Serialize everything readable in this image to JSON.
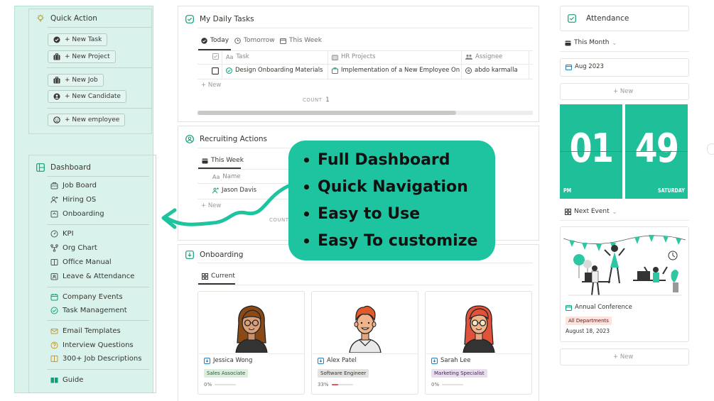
{
  "colors": {
    "accent": "#1ec39f",
    "teal_dark": "#0f9f7a",
    "sidebar_bg": "#d9f2ec"
  },
  "sidebar": {
    "quick_action": {
      "title": "Quick Action",
      "buttons": [
        "+ New Task",
        "+ New Project",
        "+ New Job",
        "+ New Candidate",
        "+ New employee"
      ]
    },
    "dashboard": {
      "title": "Dashboard",
      "items": [
        "Job Board",
        "Hiring OS",
        "Onboarding",
        "KPI",
        "Org Chart",
        "Office Manual",
        "Leave & Attendance",
        "Company Events",
        "Task Management",
        "Email Templates",
        "Interview Questions",
        "300+ Job Descriptions",
        "Guide"
      ]
    }
  },
  "daily_tasks": {
    "title": "My Daily Tasks",
    "tabs": [
      "Today",
      "Tomorrow",
      "This Week"
    ],
    "columns": [
      "Task",
      "HR Projects",
      "Assignee"
    ],
    "rows": [
      {
        "task": "Design Onboarding Materials",
        "project": "Implementation of a New Employee Onboa",
        "assignee": "abdo karmalla"
      }
    ],
    "new_label": "New",
    "count_label": "COUNT",
    "count_value": "1"
  },
  "recruiting": {
    "title": "Recruiting Actions",
    "tab": "This Week",
    "column": "Name",
    "rows": [
      "Jason Davis"
    ],
    "new_label": "New",
    "count_label": "COUNT"
  },
  "onboarding": {
    "title": "Onboarding",
    "tab": "Current",
    "people": [
      {
        "name": "Jessica Wong",
        "role": "Sales Associate",
        "progress": "0%",
        "progress_value": 0
      },
      {
        "name": "Alex Patel",
        "role": "Software Engineer",
        "progress": "33%",
        "progress_value": 0.33
      },
      {
        "name": "Sarah Lee",
        "role": "Marketing Specialist",
        "progress": "0%",
        "progress_value": 0
      }
    ]
  },
  "attendance": {
    "title": "Attendance",
    "filter": "This Month",
    "month": "Aug 2023",
    "new_label": "New",
    "clock": {
      "hours": "01",
      "minutes": "49",
      "period": "PM",
      "day": "SATURDAY"
    },
    "next_event_label": "Next Event",
    "event": {
      "name": "Annual Conference",
      "tag": "All Departments",
      "date": "August 18, 2023"
    },
    "new_label_2": "New"
  },
  "overlay": {
    "bullets": [
      "Full Dashboard",
      "Quick Navigation",
      "Easy to Use",
      "Easy To customize"
    ]
  }
}
